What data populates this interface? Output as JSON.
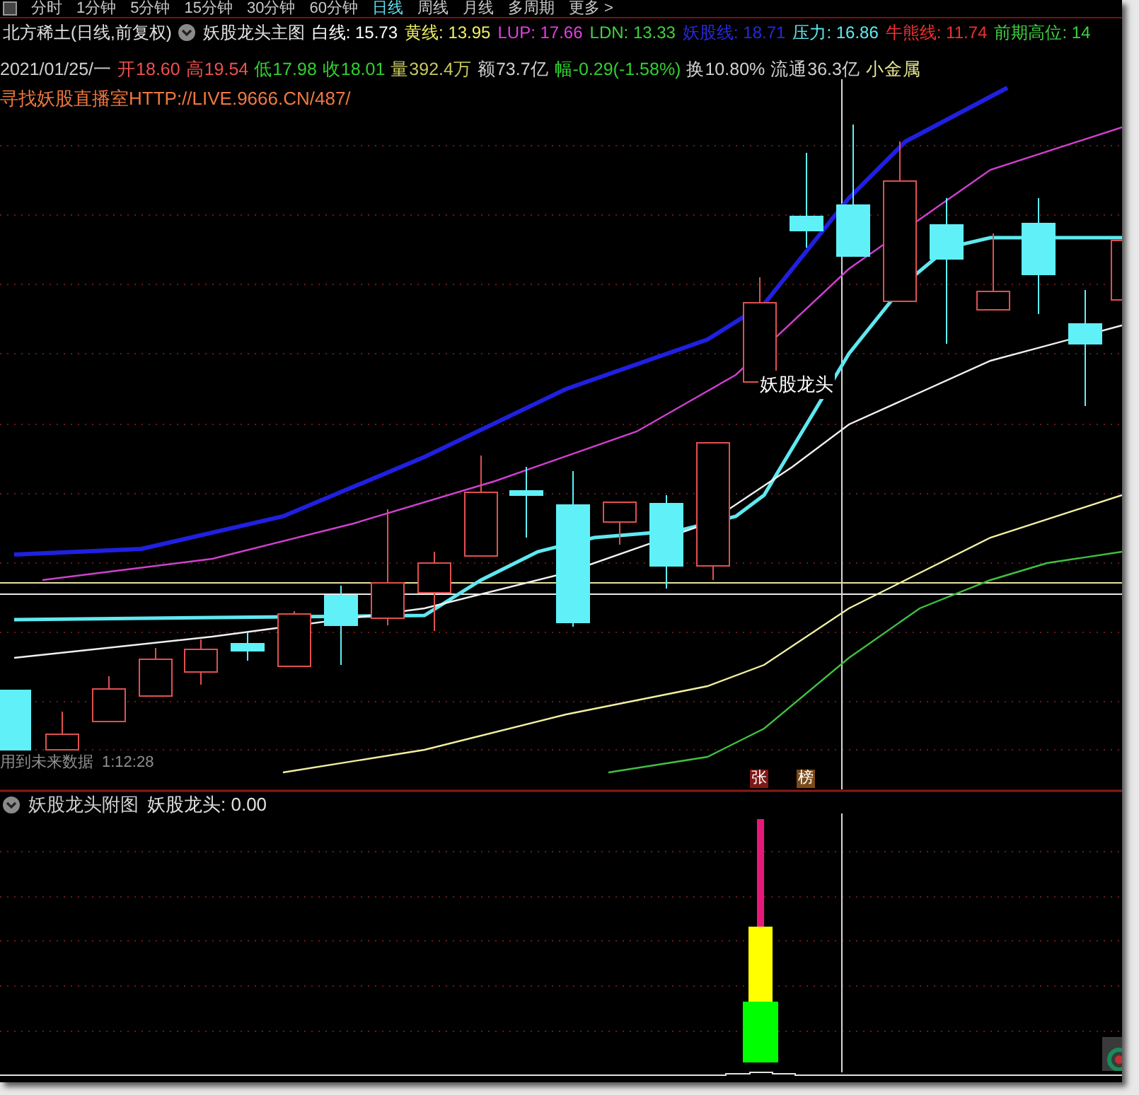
{
  "period_tabs": [
    {
      "label": "分时",
      "selected": false
    },
    {
      "label": "1分钟",
      "selected": false
    },
    {
      "label": "5分钟",
      "selected": false
    },
    {
      "label": "15分钟",
      "selected": false
    },
    {
      "label": "30分钟",
      "selected": false
    },
    {
      "label": "60分钟",
      "selected": false
    },
    {
      "label": "日线",
      "selected": true
    },
    {
      "label": "周线",
      "selected": false
    },
    {
      "label": "月线",
      "selected": false
    },
    {
      "label": "多周期",
      "selected": false
    },
    {
      "label": "更多 >",
      "selected": false
    }
  ],
  "main_chart": {
    "stock_title": "北方稀土(日线,前复权)",
    "indicator_name": "妖股龙头主图",
    "indicators": [
      {
        "label": "白线:",
        "value": "15.73",
        "color": "#ffffff"
      },
      {
        "label": "黄线:",
        "value": "13.95",
        "color": "#f0f060"
      },
      {
        "label": "LUP:",
        "value": "17.66",
        "color": "#e040e0"
      },
      {
        "label": "LDN:",
        "value": "13.33",
        "color": "#40d040"
      },
      {
        "label": "妖股线:",
        "value": "18.71",
        "color": "#2828e0"
      },
      {
        "label": "压力:",
        "value": "16.86",
        "color": "#60e8f0"
      },
      {
        "label": "牛熊线:",
        "value": "11.74",
        "color": "#f03030"
      },
      {
        "label": "前期高位:",
        "value": "14",
        "color": "#40d040"
      }
    ],
    "quote": [
      {
        "text": "2021/01/25/一",
        "color": "#d0d0d0"
      },
      {
        "text": "开18.60",
        "color": "#f05050"
      },
      {
        "text": "高19.54",
        "color": "#f05050"
      },
      {
        "text": "低17.98",
        "color": "#30d030"
      },
      {
        "text": "收18.01",
        "color": "#30d030"
      },
      {
        "text": "量392.4万",
        "color": "#c8c860"
      },
      {
        "text": "额73.7亿",
        "color": "#d0d0d0"
      },
      {
        "text": "幅-0.29(-1.58%)",
        "color": "#30d030"
      },
      {
        "text": "换10.80%",
        "color": "#d0d0d0"
      },
      {
        "text": "流通36.3亿",
        "color": "#d0d0d0"
      },
      {
        "text": "小金属",
        "color": "#e8e890"
      }
    ],
    "promo_link": "寻找妖股直播室HTTP://LIVE.9666.CN/487/",
    "signal_label": "妖股龙头",
    "badges": [
      {
        "text": "张",
        "color": "#801818"
      },
      {
        "text": "榜",
        "color": "#7a4a18"
      }
    ],
    "footnote": "用到未来数据",
    "time_text": "1:12:28"
  },
  "sub_chart": {
    "indicator_name": "妖股龙头附图",
    "reading_label": "妖股龙头:",
    "reading_value": "0.00"
  }
}
